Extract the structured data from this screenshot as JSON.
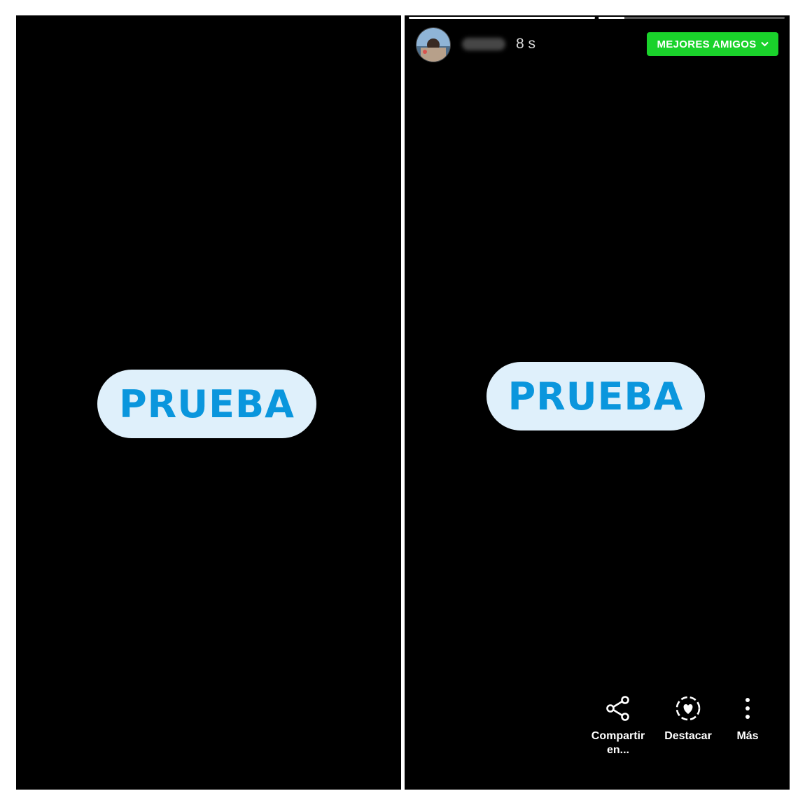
{
  "left_panel": {
    "sticker_text": "PRUEBA"
  },
  "right_panel": {
    "progress": [
      {
        "fraction": 1.0
      },
      {
        "fraction": 0.14
      }
    ],
    "header": {
      "username": "mm_gr",
      "timestamp": "8 s",
      "audience_button": "MEJORES AMIGOS",
      "audience_icon": "chevron-down-icon",
      "audience_color": "#1ad22b"
    },
    "sticker_text": "PRUEBA",
    "actions": [
      {
        "label_line1": "Compartir",
        "label_line2": "en...",
        "icon": "share-icon"
      },
      {
        "label_line1": "Destacar",
        "icon": "highlight-heart-icon"
      },
      {
        "label_line1": "Más",
        "icon": "more-vertical-icon"
      }
    ]
  },
  "colors": {
    "sticker_bg": "#dff0fb",
    "sticker_text": "#0a96dd",
    "panel_bg": "#000000"
  }
}
